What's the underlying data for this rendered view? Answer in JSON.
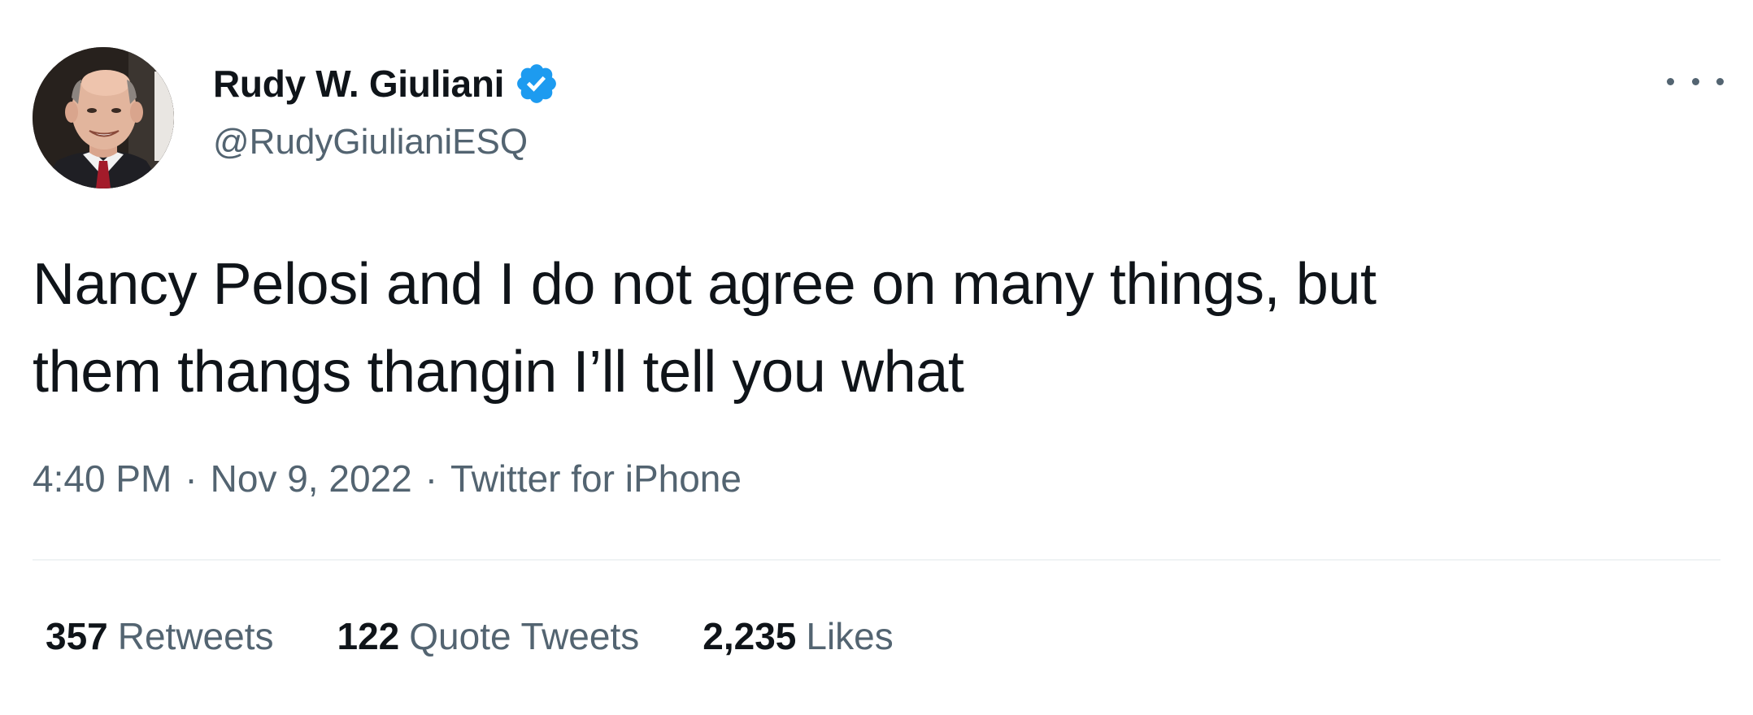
{
  "author": {
    "display_name": "Rudy W. Giuliani",
    "handle": "@RudyGiulianiESQ",
    "verified_badge_icon": "verified-check-icon",
    "verified_color": "#1d9bf0"
  },
  "tweet": {
    "text": "Nancy Pelosi and I do not agree on many things, but\nthem thangs thangin I’ll tell you what",
    "time": "4:40 PM",
    "separator": "·",
    "date": "Nov 9, 2022",
    "source": "Twitter for iPhone"
  },
  "more_menu_icon": "more-options-icon",
  "stats": {
    "retweets_count": "357",
    "retweets_label": "Retweets",
    "quotes_count": "122",
    "quotes_label": "Quote Tweets",
    "likes_count": "2,235",
    "likes_label": "Likes"
  },
  "colors": {
    "primary_text": "#0f1419",
    "secondary_text": "#536471",
    "divider": "#eff3f4"
  }
}
